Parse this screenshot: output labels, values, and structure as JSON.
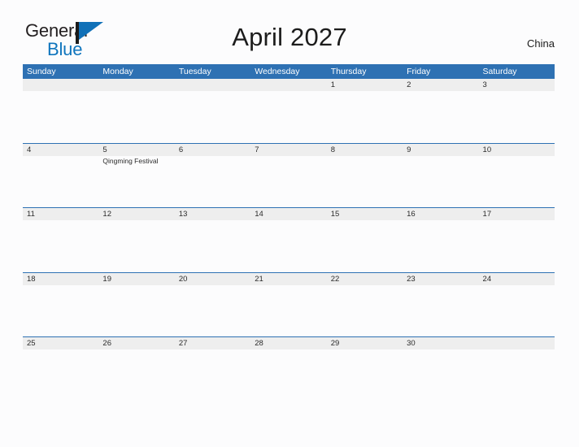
{
  "brand": {
    "name_part1": "General",
    "name_part2": "Blue",
    "flag_icon": "blue-triangle-flag-icon"
  },
  "header": {
    "title": "April 2027",
    "region": "China"
  },
  "calendar": {
    "colors": {
      "header_blue": "#2e71b3",
      "row_strip_gray": "#eeeeee",
      "page_background": "#fcfcfd",
      "brand_blue": "#0f75bd",
      "text": "#2b2b2b"
    },
    "day_headers": [
      "Sunday",
      "Monday",
      "Tuesday",
      "Wednesday",
      "Thursday",
      "Friday",
      "Saturday"
    ],
    "weeks": [
      {
        "days": [
          {
            "date": "",
            "events": []
          },
          {
            "date": "",
            "events": []
          },
          {
            "date": "",
            "events": []
          },
          {
            "date": "",
            "events": []
          },
          {
            "date": "1",
            "events": []
          },
          {
            "date": "2",
            "events": []
          },
          {
            "date": "3",
            "events": []
          }
        ]
      },
      {
        "days": [
          {
            "date": "4",
            "events": []
          },
          {
            "date": "5",
            "events": [
              "Qingming Festival"
            ]
          },
          {
            "date": "6",
            "events": []
          },
          {
            "date": "7",
            "events": []
          },
          {
            "date": "8",
            "events": []
          },
          {
            "date": "9",
            "events": []
          },
          {
            "date": "10",
            "events": []
          }
        ]
      },
      {
        "days": [
          {
            "date": "11",
            "events": []
          },
          {
            "date": "12",
            "events": []
          },
          {
            "date": "13",
            "events": []
          },
          {
            "date": "14",
            "events": []
          },
          {
            "date": "15",
            "events": []
          },
          {
            "date": "16",
            "events": []
          },
          {
            "date": "17",
            "events": []
          }
        ]
      },
      {
        "days": [
          {
            "date": "18",
            "events": []
          },
          {
            "date": "19",
            "events": []
          },
          {
            "date": "20",
            "events": []
          },
          {
            "date": "21",
            "events": []
          },
          {
            "date": "22",
            "events": []
          },
          {
            "date": "23",
            "events": []
          },
          {
            "date": "24",
            "events": []
          }
        ]
      },
      {
        "days": [
          {
            "date": "25",
            "events": []
          },
          {
            "date": "26",
            "events": []
          },
          {
            "date": "27",
            "events": []
          },
          {
            "date": "28",
            "events": []
          },
          {
            "date": "29",
            "events": []
          },
          {
            "date": "30",
            "events": []
          },
          {
            "date": "",
            "events": []
          }
        ]
      }
    ]
  }
}
